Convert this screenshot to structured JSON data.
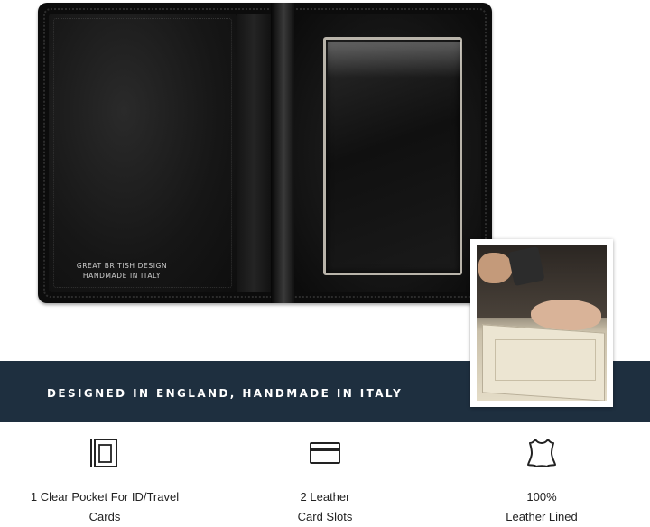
{
  "product_image": {
    "emboss_line1": "GREAT BRITISH DESIGN",
    "emboss_line2": "HANDMADE IN ITALY"
  },
  "banner": {
    "text": "DESIGNED IN ENGLAND, HANDMADE IN ITALY",
    "color": "#1e2f3f"
  },
  "features": [
    {
      "icon": "id-pocket-icon",
      "line1": "1 Clear Pocket For ID/Travel",
      "line2": "Cards"
    },
    {
      "icon": "card-slot-icon",
      "line1": "2 Leather",
      "line2": "Card Slots"
    },
    {
      "icon": "leather-hide-icon",
      "line1": "100%",
      "line2": "Leather Lined"
    }
  ]
}
